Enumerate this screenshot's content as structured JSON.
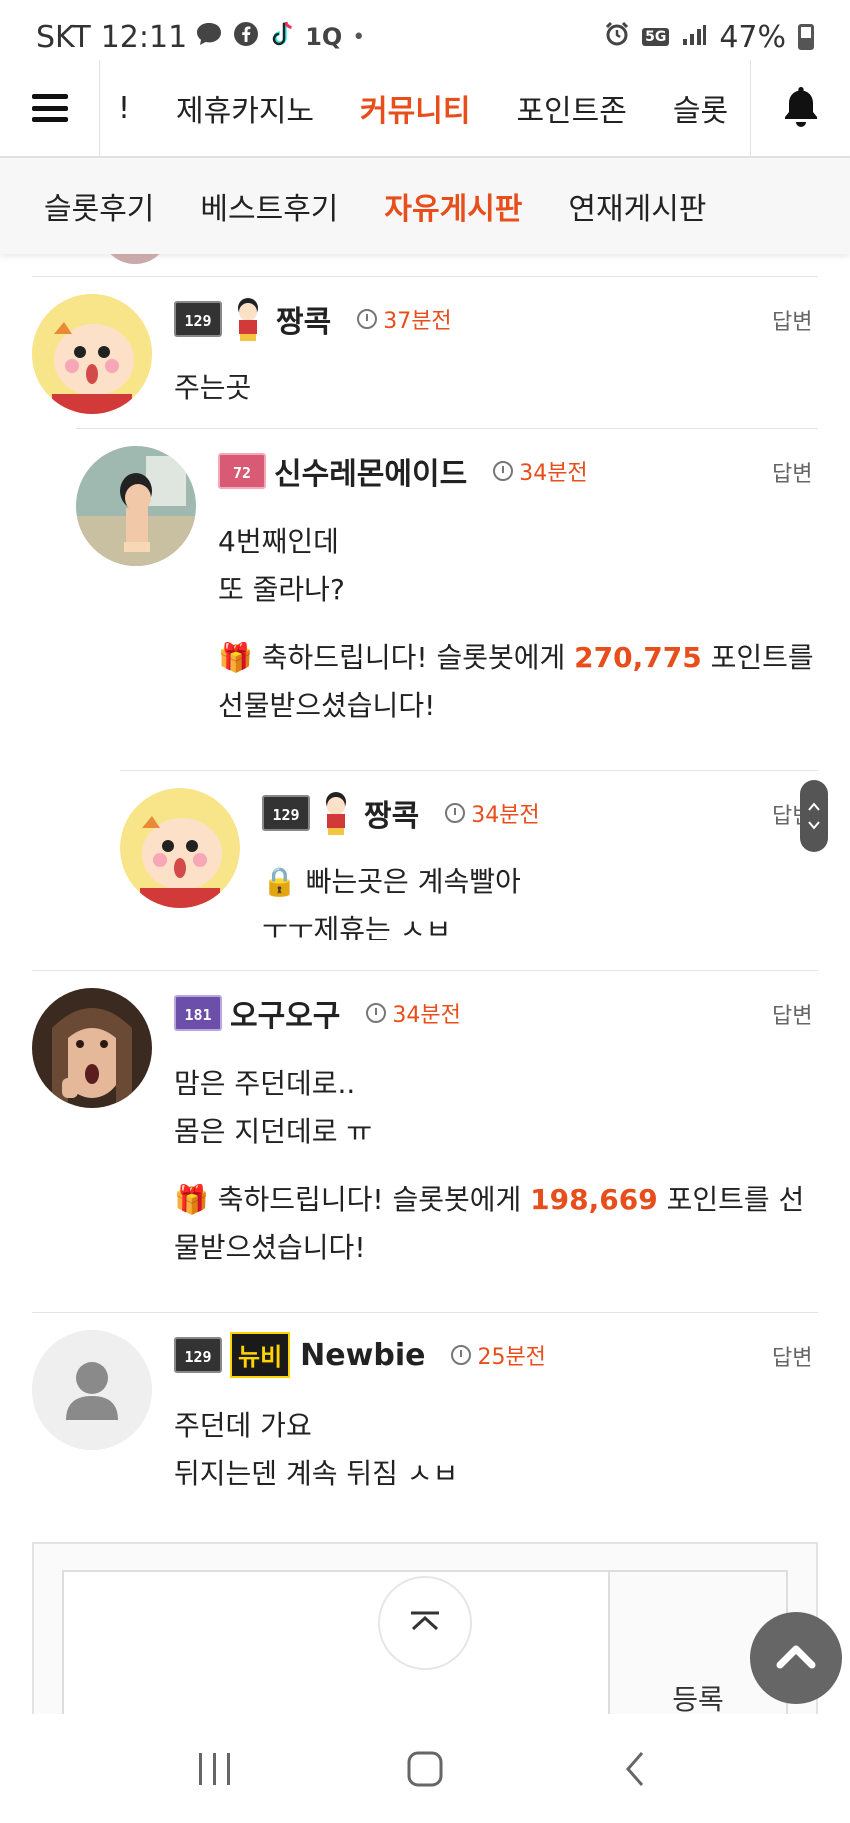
{
  "status_bar": {
    "carrier": "SKT",
    "time": "12:11",
    "network": "5G",
    "battery": "47%",
    "icons": [
      "chat-icon",
      "facebook-icon",
      "tiktok-icon",
      "app-icon",
      "dot-icon",
      "alarm-icon",
      "signal-icon",
      "battery-icon"
    ]
  },
  "nav": {
    "items": [
      "!",
      "제휴카지노",
      "커뮤니티",
      "포인트존",
      "슬롯"
    ],
    "active_index": 2
  },
  "subtabs": {
    "items": [
      "슬롯후기",
      "베스트후기",
      "자유게시판",
      "연재게시판"
    ],
    "active_index": 2
  },
  "comments": [
    {
      "level": "129",
      "nick": "짱콕",
      "time": "37분전",
      "reply": "답변",
      "lines": [
        "주는곳"
      ]
    },
    {
      "level": "72",
      "nick": "신수레몬에이드",
      "time": "34분전",
      "reply": "답변",
      "lines": [
        "4번째인데",
        "또 줄라나?"
      ],
      "gift": {
        "pre": "축하드립니다! 슬롯봇에게 ",
        "points": "270,775",
        "post": " 포인트를",
        "line2": "선물받으셨습니다!"
      }
    },
    {
      "level": "129",
      "nick": "짱콕",
      "time": "34분전",
      "reply": "답변",
      "lines": [
        "빠는곳은 계속빨아",
        "ㅜㅜ제휴는 ㅅㅂ"
      ]
    },
    {
      "level": "181",
      "nick": "오구오구",
      "time": "34분전",
      "reply": "답변",
      "lines": [
        "맘은 주던데로..",
        "몸은 지던데로 ㅠ"
      ],
      "gift": {
        "pre": "축하드립니다! 슬롯봇에게 ",
        "points": "198,669",
        "post": " 포인트를 선",
        "line2": "물받으셨습니다!"
      }
    },
    {
      "level": "129",
      "badge": "뉴비",
      "nick": "Newbie",
      "time": "25분전",
      "reply": "답변",
      "lines": [
        "주던데 가요",
        "뒤지는덴 계속 뒤짐 ㅅㅂ"
      ]
    }
  ],
  "form": {
    "submit_label": "등록"
  },
  "colors": {
    "accent": "#e84e1b"
  }
}
